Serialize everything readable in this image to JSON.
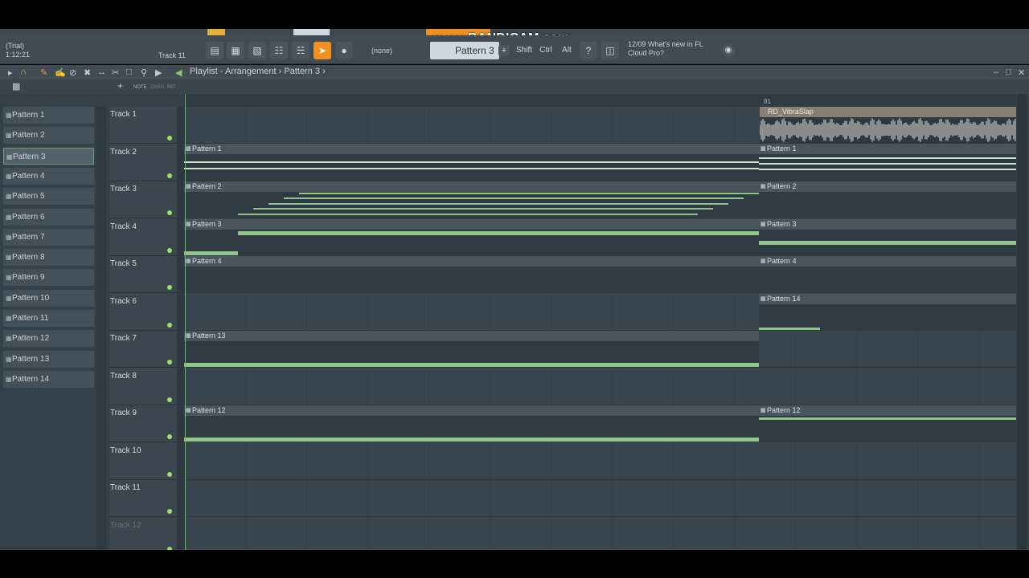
{
  "watermark": "www.BANDICAM.com",
  "toolbar": {
    "trial": "(Trial)",
    "time": "1:12:21",
    "track_label": "Track 11",
    "none_select": "(none)",
    "pattern_select": "Pattern 3",
    "keys": [
      "Shift",
      "Ctrl",
      "Alt"
    ],
    "news_line1": "12/09  What's new in FL",
    "news_line2": "Cloud Pro?"
  },
  "playlist": {
    "crumb": "Playlist - Arrangement › Pattern 3 ›",
    "sub_labels": [
      "NOTE",
      "CHAN",
      "PAT"
    ],
    "marker": "81"
  },
  "patterns": [
    "Pattern 1",
    "Pattern 2",
    "Pattern 3",
    "Pattern 4",
    "Pattern 5",
    "Pattern 6",
    "Pattern 7",
    "Pattern 8",
    "Pattern 9",
    "Pattern 10",
    "Pattern 11",
    "Pattern 12",
    "Pattern 13",
    "Pattern 14"
  ],
  "selected_pattern_index": 2,
  "tracks": [
    "Track 1",
    "Track 2",
    "Track 3",
    "Track 4",
    "Track 5",
    "Track 6",
    "Track 7",
    "Track 8",
    "Track 9",
    "Track 10",
    "Track 11",
    "Track 12"
  ],
  "audio_clip": "RD_VibraSlap",
  "clip_names": {
    "t2a": "Pattern 1",
    "t2b": "Pattern 1",
    "t3a": "Pattern 2",
    "t3b": "Pattern 2",
    "t4a": "Pattern 3",
    "t4b": "Pattern 3",
    "t5a": "Pattern 4",
    "t5b": "Pattern 4",
    "t6b": "Pattern 14",
    "t7a": "Pattern 13",
    "t9a": "Pattern 12",
    "t9b": "Pattern 12"
  },
  "colors": {
    "accent_orange": "#f0901e",
    "note_green": "#8fc48a",
    "playhead": "#6fb64c"
  }
}
